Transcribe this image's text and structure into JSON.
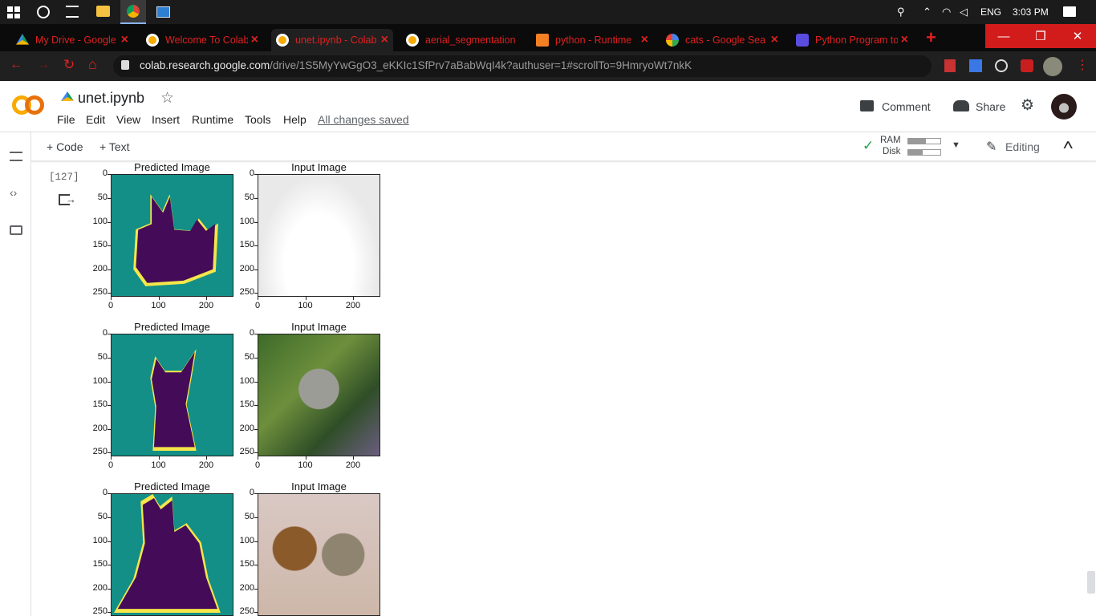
{
  "taskbar": {
    "language": "ENG",
    "time": "3:03 PM"
  },
  "tabs": [
    {
      "title": "My Drive - Google"
    },
    {
      "title": "Welcome To Colab"
    },
    {
      "title": "unet.ipynb - Colab"
    },
    {
      "title": "aerial_segmentation"
    },
    {
      "title": "python - Runtime"
    },
    {
      "title": "cats - Google Sea"
    },
    {
      "title": "Python Program to"
    }
  ],
  "address": {
    "host": "colab.research.google.com",
    "path": "/drive/1S5MyYwGgO3_eKKIc1SfPrv7aBabWqI4k?authuser=1#scrollTo=9HmryoWt7nkK"
  },
  "notebook": {
    "name": "unet.ipynb",
    "menu": [
      "File",
      "Edit",
      "View",
      "Insert",
      "Runtime",
      "Tools",
      "Help"
    ],
    "saved_status": "All changes saved",
    "comment_label": "Comment",
    "share_label": "Share"
  },
  "toolbar": {
    "code_label": "+ Code",
    "text_label": "+ Text",
    "ram_label": "RAM",
    "disk_label": "Disk",
    "editing_label": "Editing",
    "ram_fraction": 0.55,
    "disk_fraction": 0.45
  },
  "cell": {
    "exec_count": "[127]"
  },
  "figures": {
    "predicted_title": "Predicted Image",
    "input_title": "Input Image",
    "y_ticks": [
      "0",
      "50",
      "100",
      "150",
      "200",
      "250"
    ],
    "x_ticks": [
      "0",
      "100",
      "200"
    ]
  }
}
